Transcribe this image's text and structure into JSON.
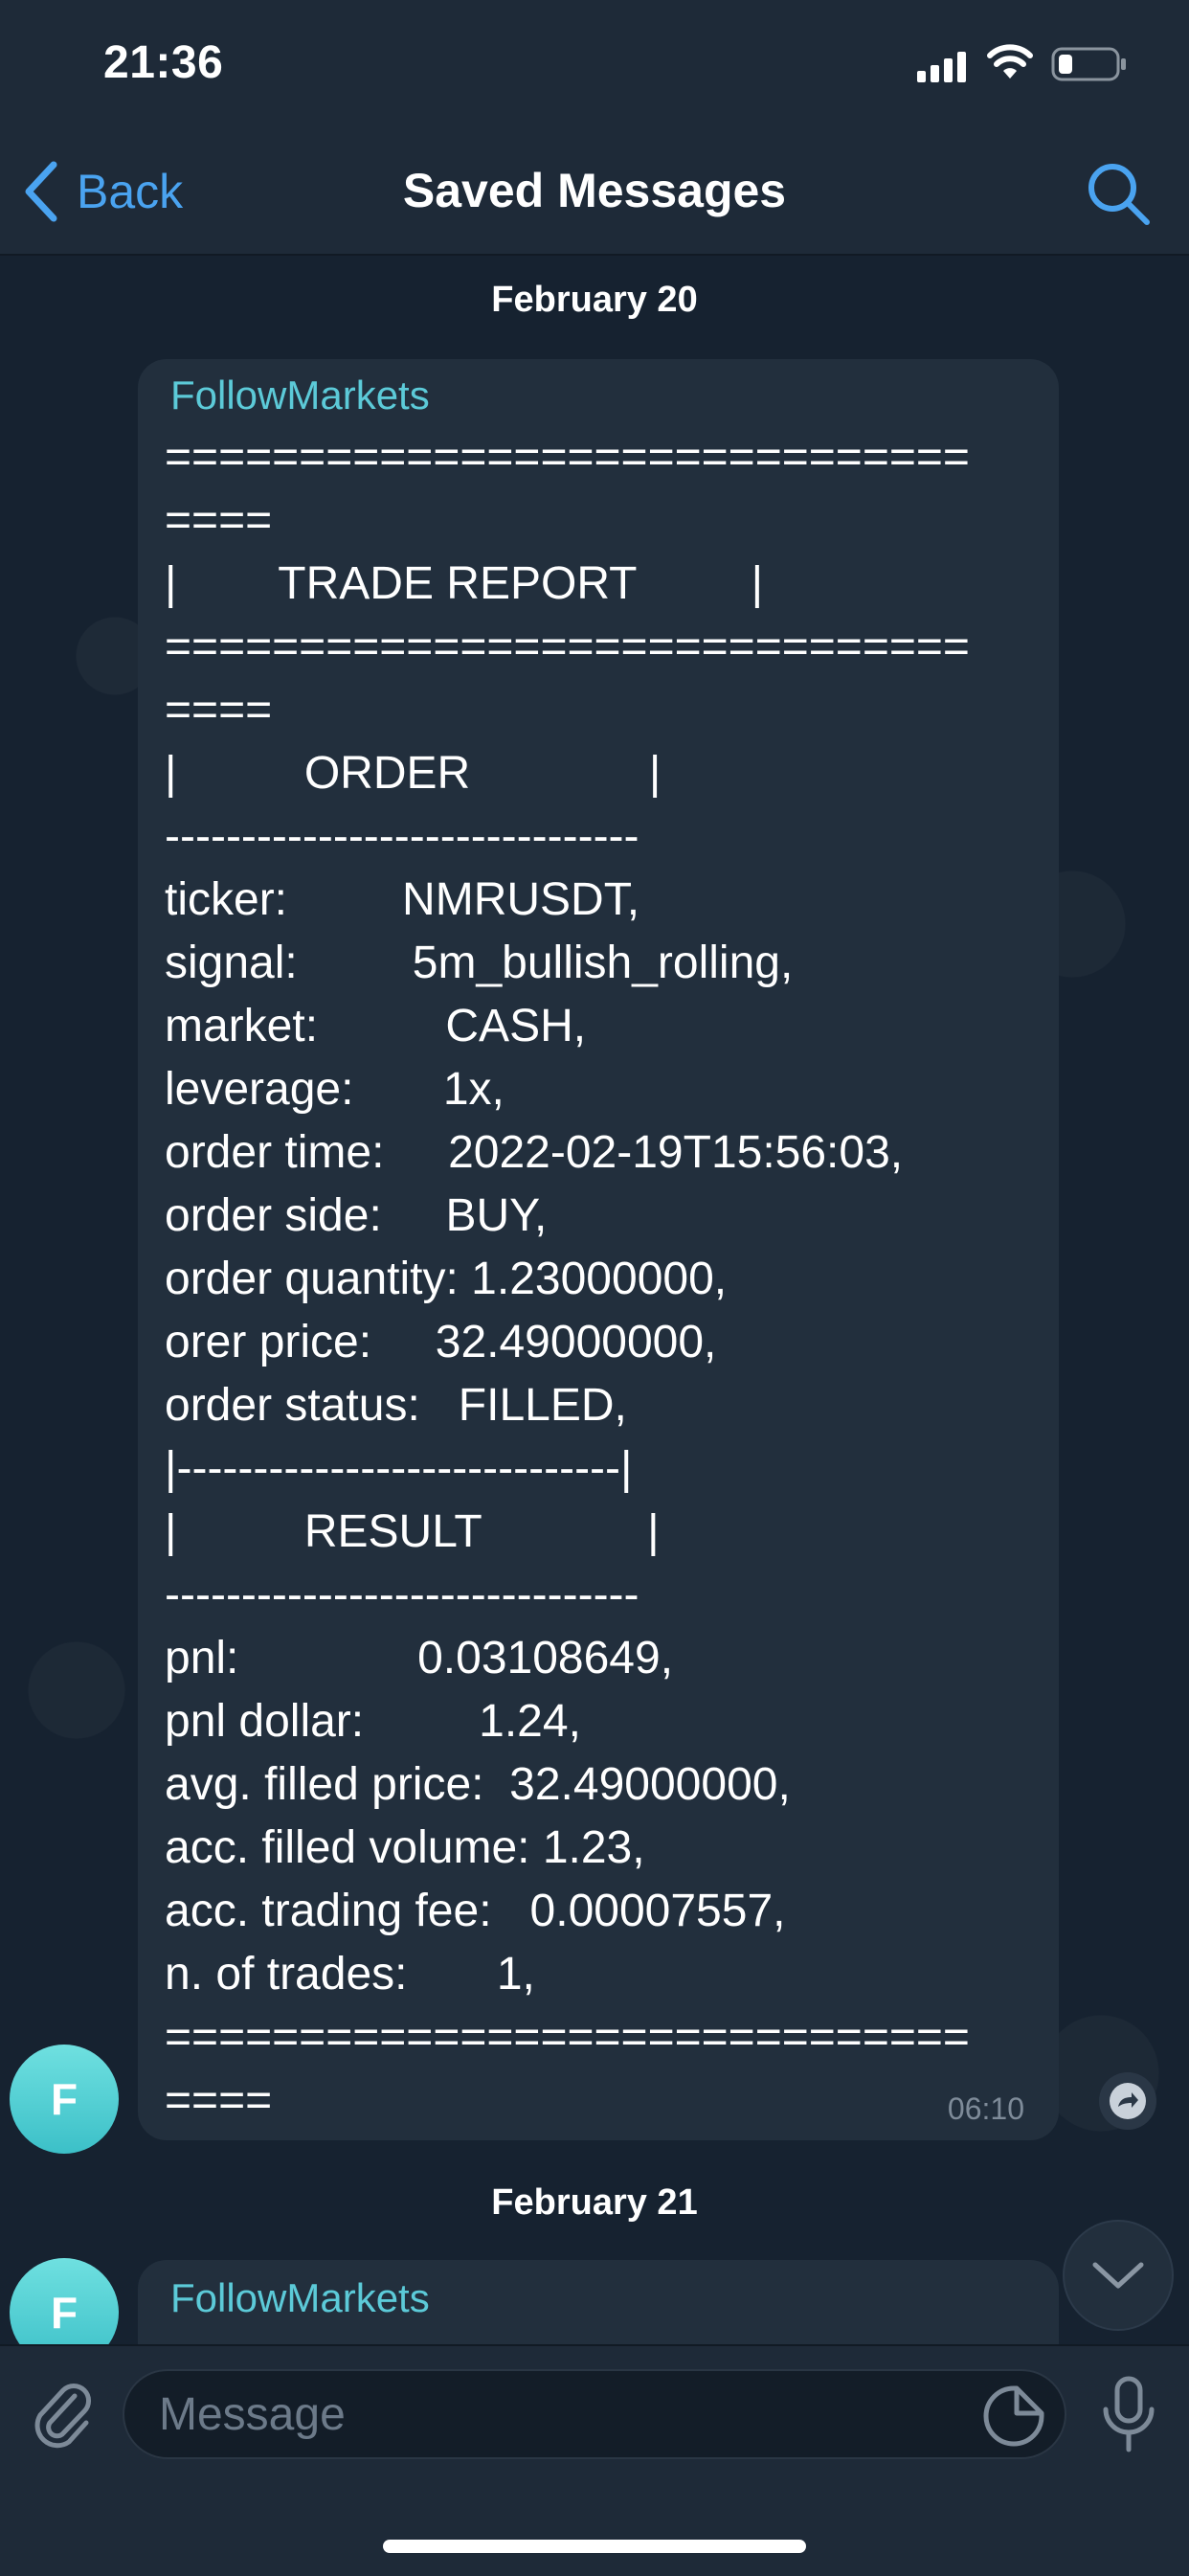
{
  "status_bar": {
    "time": "21:36"
  },
  "nav": {
    "back_label": "Back",
    "title": "Saved Messages"
  },
  "dates": {
    "first": "February 20",
    "second": "February 21"
  },
  "messages": [
    {
      "sender": "FollowMarkets",
      "avatar_letter": "F",
      "time": "06:10",
      "lines": [
        "==============================",
        "====",
        "|        TRADE REPORT         |",
        "==============================",
        "====",
        "|          ORDER              |",
        "-------------------------------",
        "ticker:         NMRUSDT,",
        "signal:         5m_bullish_rolling,",
        "market:          CASH,",
        "leverage:       1x,",
        "order time:     2022-02-19T15:56:03,",
        "order side:     BUY,",
        "order quantity: 1.23000000,",
        "orer price:     32.49000000,",
        "order status:   FILLED,",
        "|-----------------------------|",
        "|          RESULT             |",
        "-------------------------------",
        "pnl:              0.03108649,",
        "pnl dollar:         1.24,",
        "avg. filled price:  32.49000000,",
        "acc. filled volume: 1.23,",
        "acc. trading fee:   0.00007557,",
        "n. of trades:       1,",
        "==============================",
        "===="
      ]
    },
    {
      "sender": "FollowMarkets",
      "avatar_letter": "F"
    }
  ],
  "input": {
    "placeholder": "Message"
  },
  "icons": {
    "accent": "#4aa3f0",
    "sender_color": "#5ccad8"
  }
}
